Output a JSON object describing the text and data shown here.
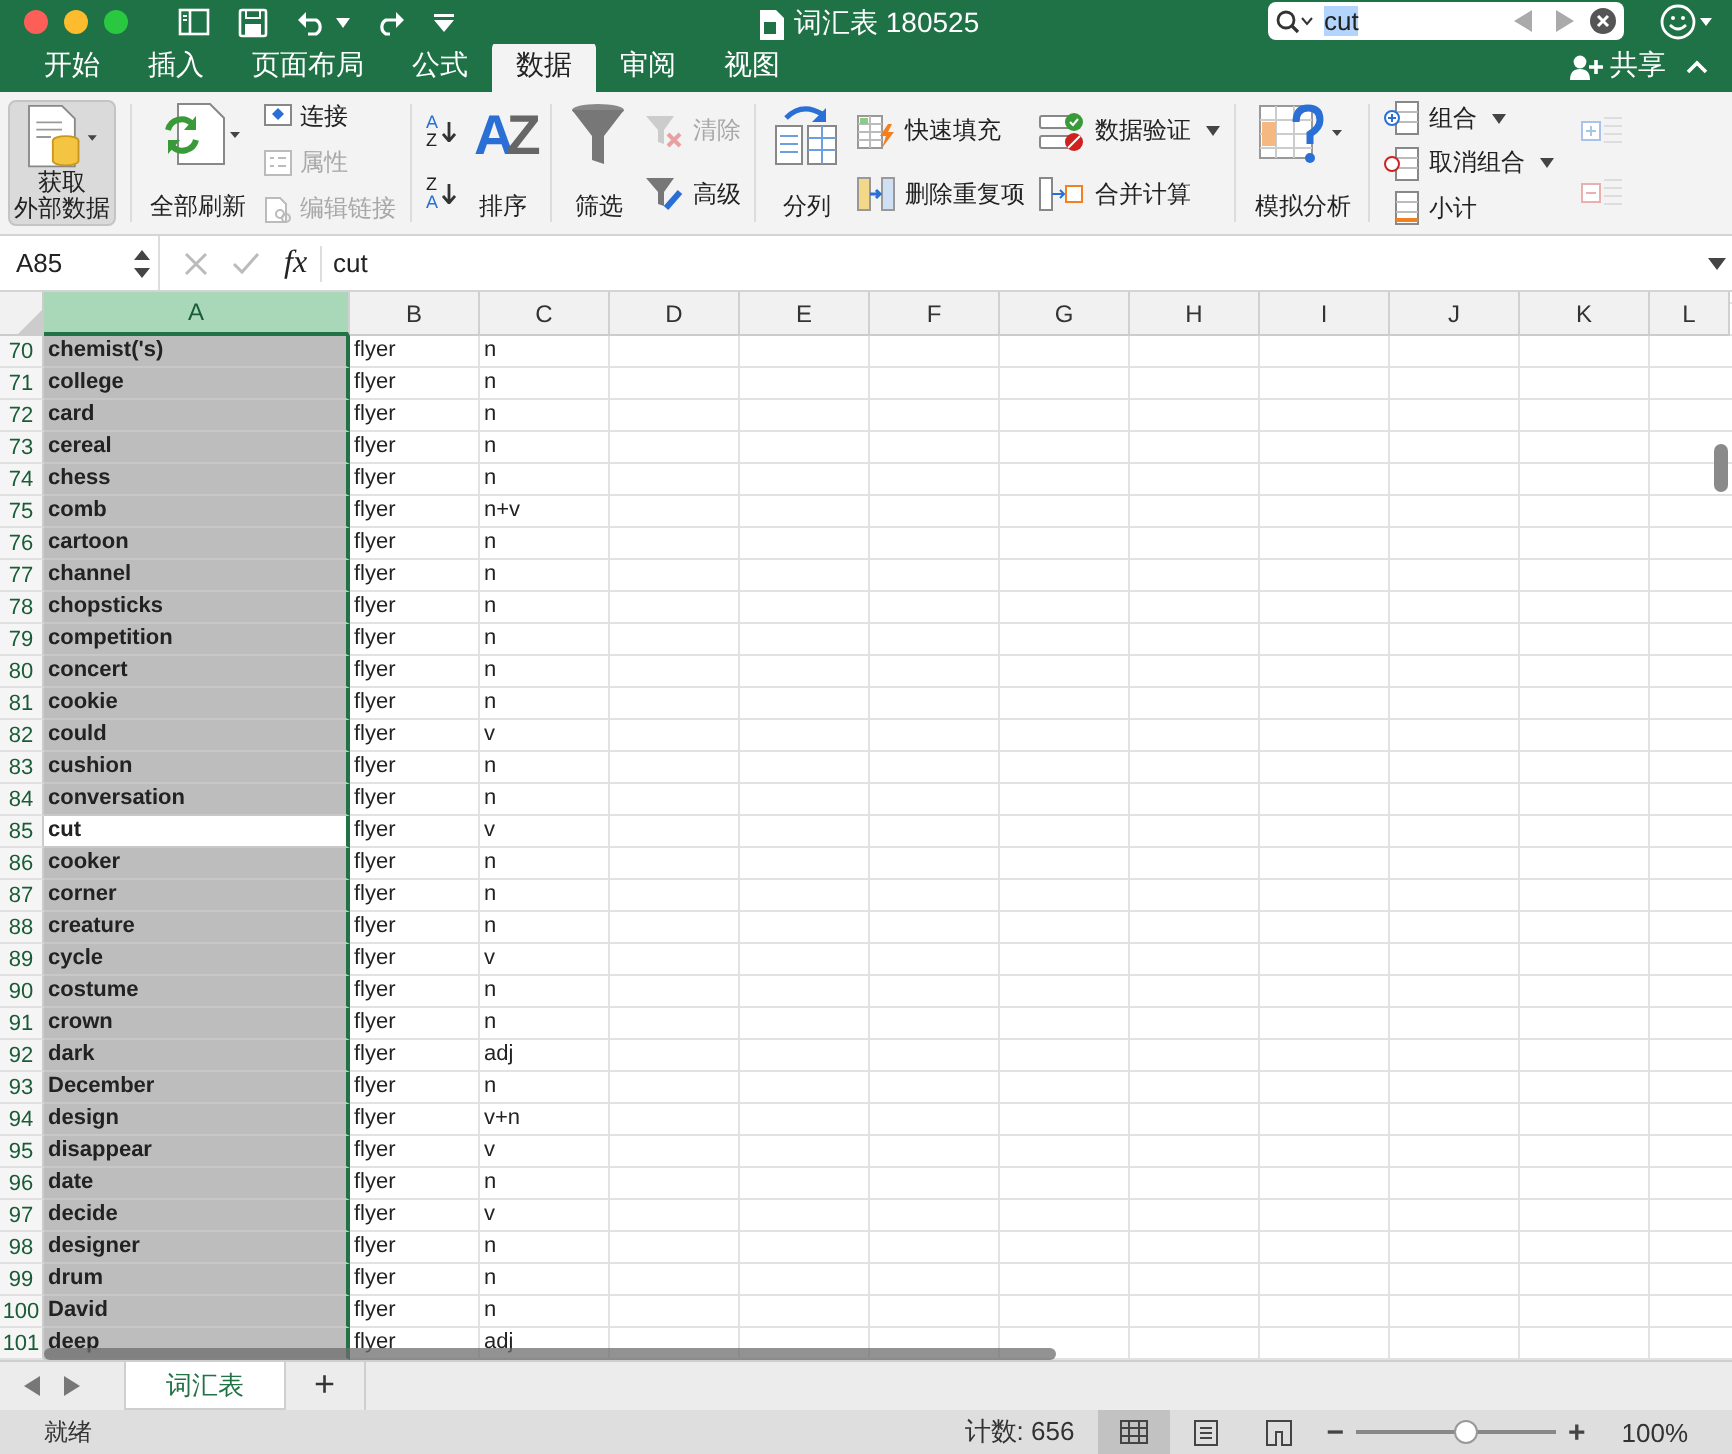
{
  "title_bar": {
    "title": "词汇表 180525",
    "search": {
      "value": "cut"
    }
  },
  "tabs": [
    {
      "label": "开始",
      "selected": false
    },
    {
      "label": "插入",
      "selected": false
    },
    {
      "label": "页面布局",
      "selected": false
    },
    {
      "label": "公式",
      "selected": false
    },
    {
      "label": "数据",
      "selected": true
    },
    {
      "label": "审阅",
      "selected": false
    },
    {
      "label": "视图",
      "selected": false
    }
  ],
  "share": {
    "label": "共享"
  },
  "ribbon": {
    "get_external_data": {
      "lines": [
        "获取",
        "外部数据"
      ],
      "pressed": true
    },
    "refresh_all": {
      "label": "全部刷新"
    },
    "connections": [
      {
        "label": "连接",
        "disabled": false
      },
      {
        "label": "属性",
        "disabled": true
      },
      {
        "label": "编辑链接",
        "disabled": true
      }
    ],
    "sort_small": [
      {
        "top": "A",
        "bottom": "Z"
      },
      {
        "top": "Z",
        "bottom": "A"
      }
    ],
    "sort": {
      "glyphs": [
        "A",
        "Z"
      ],
      "label": "排序"
    },
    "filter": {
      "label": "筛选"
    },
    "filter_small": [
      {
        "label": "清除",
        "disabled": true
      },
      {
        "label": "高级",
        "disabled": false
      }
    ],
    "text_to_columns": {
      "label": "分列"
    },
    "tools_left": [
      {
        "label": "快速填充"
      },
      {
        "label": "删除重复项"
      }
    ],
    "tools_right": [
      {
        "label": "数据验证",
        "dropdown": true
      },
      {
        "label": "合并计算",
        "dropdown": false
      }
    ],
    "what_if": {
      "label": "模拟分析"
    },
    "outline": [
      {
        "label": "组合",
        "dropdown": true
      },
      {
        "label": "取消组合",
        "dropdown": true
      },
      {
        "label": "小计",
        "dropdown": false
      }
    ]
  },
  "formula_bar": {
    "name_box": "A85",
    "fx": "fx",
    "value": "cut"
  },
  "columns": [
    {
      "label": "A",
      "selected": true
    },
    {
      "label": "B",
      "selected": false
    },
    {
      "label": "C",
      "selected": false
    },
    {
      "label": "D",
      "selected": false
    },
    {
      "label": "E",
      "selected": false
    },
    {
      "label": "F",
      "selected": false
    },
    {
      "label": "G",
      "selected": false
    },
    {
      "label": "H",
      "selected": false
    },
    {
      "label": "I",
      "selected": false
    },
    {
      "label": "J",
      "selected": false
    },
    {
      "label": "K",
      "selected": false
    },
    {
      "label": "L",
      "selected": false
    }
  ],
  "rows": [
    {
      "n": "70",
      "a": "chemist('s)",
      "b": "flyer",
      "c": "n",
      "active": false
    },
    {
      "n": "71",
      "a": "college",
      "b": "flyer",
      "c": "n",
      "active": false
    },
    {
      "n": "72",
      "a": "card",
      "b": "flyer",
      "c": "n",
      "active": false
    },
    {
      "n": "73",
      "a": "cereal",
      "b": "flyer",
      "c": "n",
      "active": false
    },
    {
      "n": "74",
      "a": "chess",
      "b": "flyer",
      "c": "n",
      "active": false
    },
    {
      "n": "75",
      "a": "comb",
      "b": "flyer",
      "c": "n+v",
      "active": false
    },
    {
      "n": "76",
      "a": "cartoon",
      "b": "flyer",
      "c": "n",
      "active": false
    },
    {
      "n": "77",
      "a": "channel",
      "b": "flyer",
      "c": "n",
      "active": false
    },
    {
      "n": "78",
      "a": "chopsticks",
      "b": "flyer",
      "c": "n",
      "active": false
    },
    {
      "n": "79",
      "a": "competition",
      "b": "flyer",
      "c": "n",
      "active": false
    },
    {
      "n": "80",
      "a": "concert",
      "b": "flyer",
      "c": "n",
      "active": false
    },
    {
      "n": "81",
      "a": "cookie",
      "b": "flyer",
      "c": "n",
      "active": false
    },
    {
      "n": "82",
      "a": "could",
      "b": "flyer",
      "c": "v",
      "active": false
    },
    {
      "n": "83",
      "a": "cushion",
      "b": "flyer",
      "c": "n",
      "active": false
    },
    {
      "n": "84",
      "a": "conversation",
      "b": "flyer",
      "c": "n",
      "active": false
    },
    {
      "n": "85",
      "a": "cut",
      "b": "flyer",
      "c": "v",
      "active": true
    },
    {
      "n": "86",
      "a": "cooker",
      "b": "flyer",
      "c": "n",
      "active": false
    },
    {
      "n": "87",
      "a": "corner",
      "b": "flyer",
      "c": "n",
      "active": false
    },
    {
      "n": "88",
      "a": "creature",
      "b": "flyer",
      "c": "n",
      "active": false
    },
    {
      "n": "89",
      "a": "cycle",
      "b": "flyer",
      "c": "v",
      "active": false
    },
    {
      "n": "90",
      "a": "costume",
      "b": "flyer",
      "c": "n",
      "active": false
    },
    {
      "n": "91",
      "a": "crown",
      "b": "flyer",
      "c": "n",
      "active": false
    },
    {
      "n": "92",
      "a": "dark",
      "b": "flyer",
      "c": "adj",
      "active": false
    },
    {
      "n": "93",
      "a": "December",
      "b": "flyer",
      "c": "n",
      "active": false
    },
    {
      "n": "94",
      "a": "design",
      "b": "flyer",
      "c": "v+n",
      "active": false
    },
    {
      "n": "95",
      "a": "disappear",
      "b": "flyer",
      "c": "v",
      "active": false
    },
    {
      "n": "96",
      "a": "date",
      "b": "flyer",
      "c": "n",
      "active": false
    },
    {
      "n": "97",
      "a": "decide",
      "b": "flyer",
      "c": "v",
      "active": false
    },
    {
      "n": "98",
      "a": "designer",
      "b": "flyer",
      "c": "n",
      "active": false
    },
    {
      "n": "99",
      "a": "drum",
      "b": "flyer",
      "c": "n",
      "active": false
    },
    {
      "n": "100",
      "a": "David",
      "b": "flyer",
      "c": "n",
      "active": false
    },
    {
      "n": "101",
      "a": "deep",
      "b": "flyer",
      "c": "adj",
      "active": false
    }
  ],
  "sheet_tabs": [
    {
      "label": "词汇表",
      "selected": true
    }
  ],
  "add_sheet": "+",
  "status_bar": {
    "status": "就绪",
    "count": "计数: 656",
    "views": [
      {
        "selected": true
      },
      {
        "selected": false
      },
      {
        "selected": false
      }
    ],
    "zoom": {
      "minus": "−",
      "level": 0.55,
      "plus": "+",
      "reading": "100%"
    }
  }
}
